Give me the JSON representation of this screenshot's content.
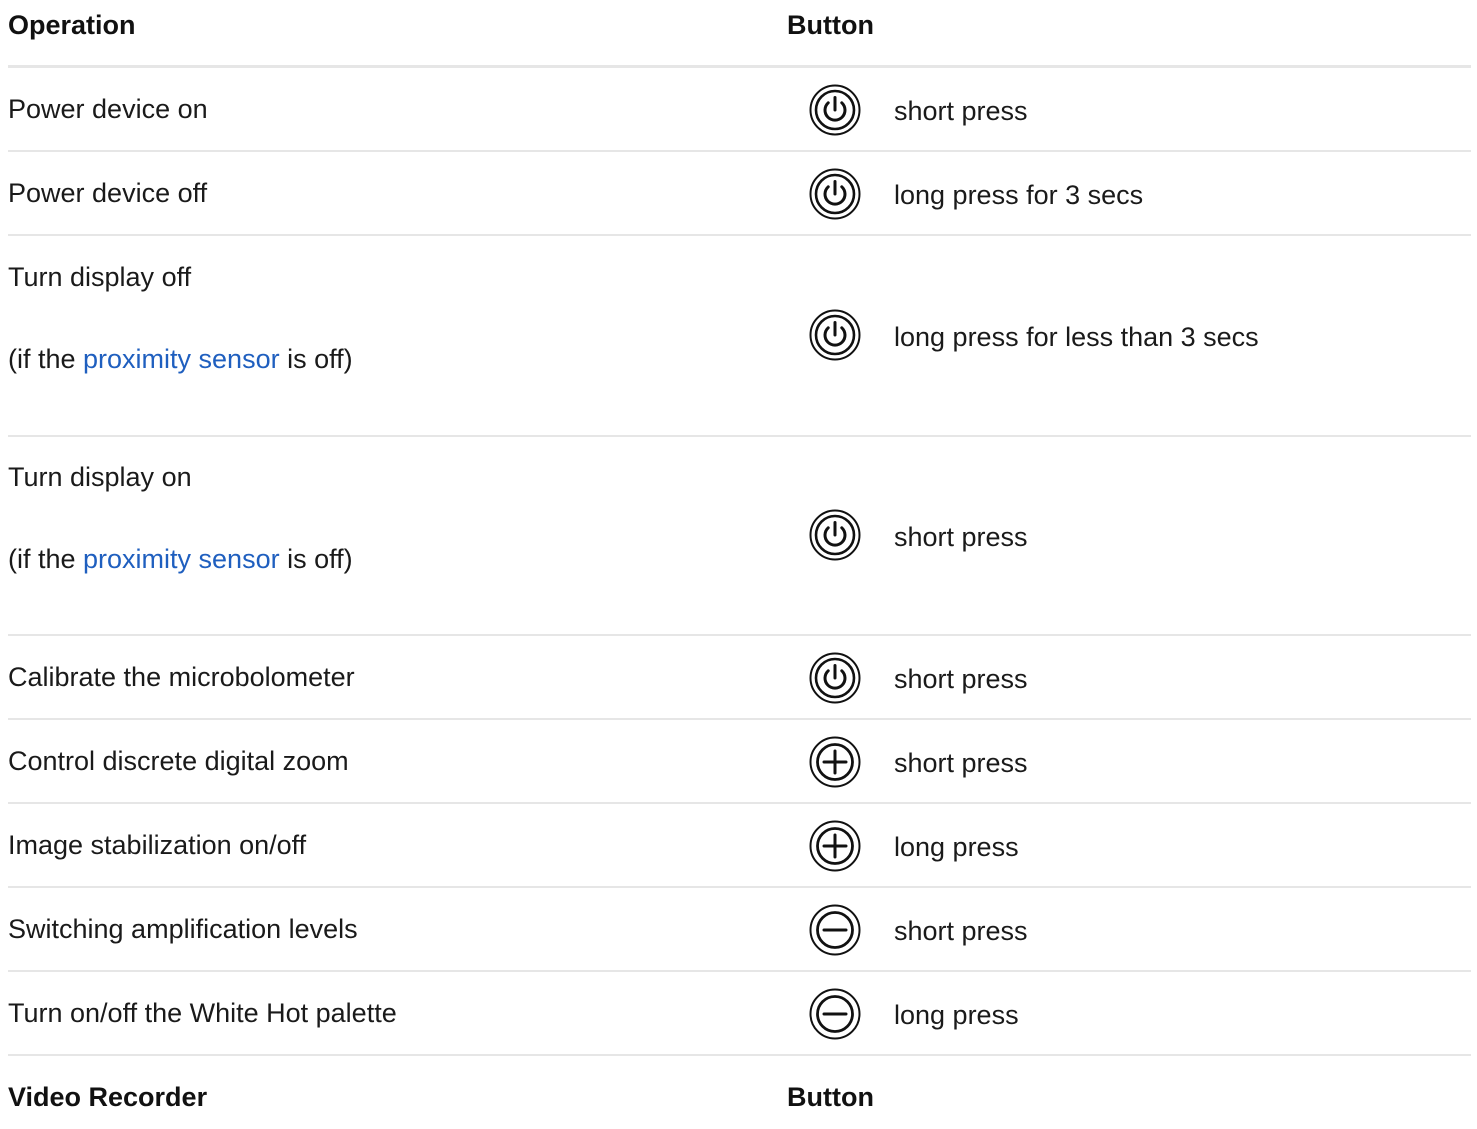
{
  "table1": {
    "header": {
      "operation": "Operation",
      "button": "Button"
    },
    "rows": [
      {
        "operation": "Power device on",
        "icon": "power-icon",
        "press": "short press"
      },
      {
        "operation": "Power device off",
        "icon": "power-icon",
        "press": "long press for 3 secs"
      },
      {
        "operation": "Turn display off",
        "note_prefix": "(if the ",
        "note_link": "proximity sensor",
        "note_suffix": " is off)",
        "icon": "power-icon",
        "press": "long press for less than 3 secs"
      },
      {
        "operation": "Turn display on",
        "note_prefix": "(if the ",
        "note_link": "proximity sensor",
        "note_suffix": " is off)",
        "icon": "power-icon",
        "press": "short press"
      },
      {
        "operation": "Calibrate the microbolometer",
        "icon": "power-icon",
        "press": "short press"
      },
      {
        "operation": "Control discrete digital zoom",
        "icon": "plus-icon",
        "press": "short press"
      },
      {
        "operation": "Image stabilization on/off",
        "icon": "plus-icon",
        "press": "long press"
      },
      {
        "operation": "Switching amplification levels",
        "icon": "minus-icon",
        "press": "short press"
      },
      {
        "operation": "Turn on/off the White Hot palette",
        "icon": "minus-icon",
        "press": "long press"
      }
    ]
  },
  "table2": {
    "header": {
      "operation": "Video Recorder",
      "button": "Button"
    }
  },
  "colors": {
    "link": "#1f5fbf",
    "divider": "#e6e6e6"
  }
}
